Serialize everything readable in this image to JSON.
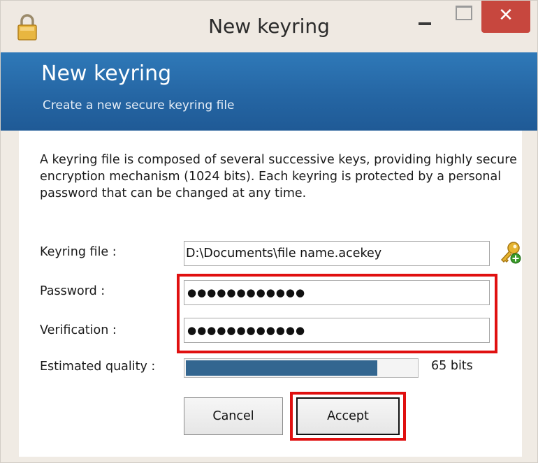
{
  "window": {
    "title": "New keyring",
    "close_glyph": "✕"
  },
  "header": {
    "title": "New keyring",
    "subtitle": "Create a new secure keyring file"
  },
  "description": "A keyring file is composed of several successive keys, providing highly secure encryption mechanism (1024 bits). Each keyring is protected by a personal password that can be changed at any time.",
  "form": {
    "keyring_file": {
      "label": "Keyring file :",
      "value": "D:\\Documents\\file name.acekey"
    },
    "password": {
      "label": "Password :",
      "value": "●●●●●●●●●●●●"
    },
    "verification": {
      "label": "Verification :",
      "value": "●●●●●●●●●●●●"
    },
    "quality": {
      "label": "Estimated quality :",
      "value_text": "65 bits",
      "fill_fraction": 0.83
    }
  },
  "buttons": {
    "cancel": "Cancel",
    "accept": "Accept"
  },
  "colors": {
    "header_blue": "#2566a4",
    "progress_fill": "#336690",
    "highlight_red": "#e01010",
    "close_red": "#c7473e"
  },
  "icons": {
    "title_icon": "lock-icon",
    "browse_icon": "key-add-icon"
  }
}
